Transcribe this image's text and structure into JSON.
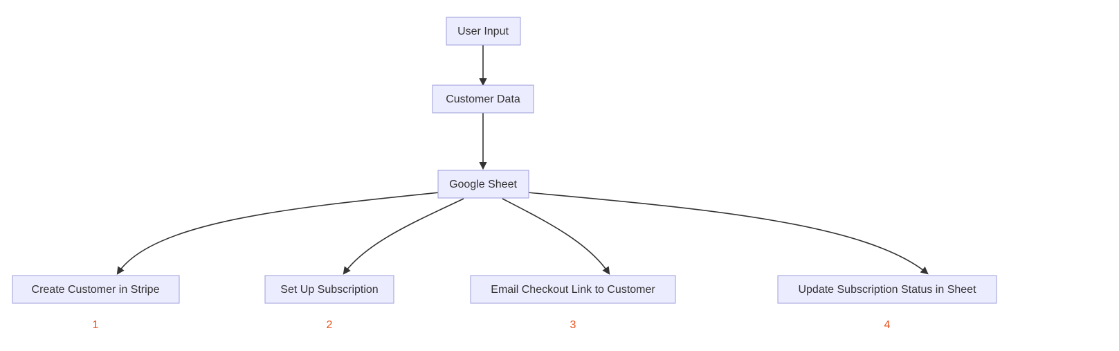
{
  "chart_data": {
    "type": "flowchart",
    "direction": "top-down",
    "nodes": [
      {
        "id": "A",
        "label": "User Input"
      },
      {
        "id": "B",
        "label": "Customer Data"
      },
      {
        "id": "C",
        "label": "Google Sheet"
      },
      {
        "id": "D",
        "label": "Create Customer in Stripe",
        "order": "1"
      },
      {
        "id": "E",
        "label": "Set Up Subscription",
        "order": "2"
      },
      {
        "id": "F",
        "label": "Email Checkout Link to Customer",
        "order": "3"
      },
      {
        "id": "G",
        "label": "Update Subscription Status in Sheet",
        "order": "4"
      }
    ],
    "edges": [
      {
        "from": "A",
        "to": "B"
      },
      {
        "from": "B",
        "to": "C"
      },
      {
        "from": "C",
        "to": "D"
      },
      {
        "from": "C",
        "to": "E"
      },
      {
        "from": "C",
        "to": "F"
      },
      {
        "from": "C",
        "to": "G"
      }
    ],
    "node_style": {
      "fill": "#ECECFF",
      "stroke": "#9D9DDB"
    },
    "order_label_color": "#E8531F"
  }
}
